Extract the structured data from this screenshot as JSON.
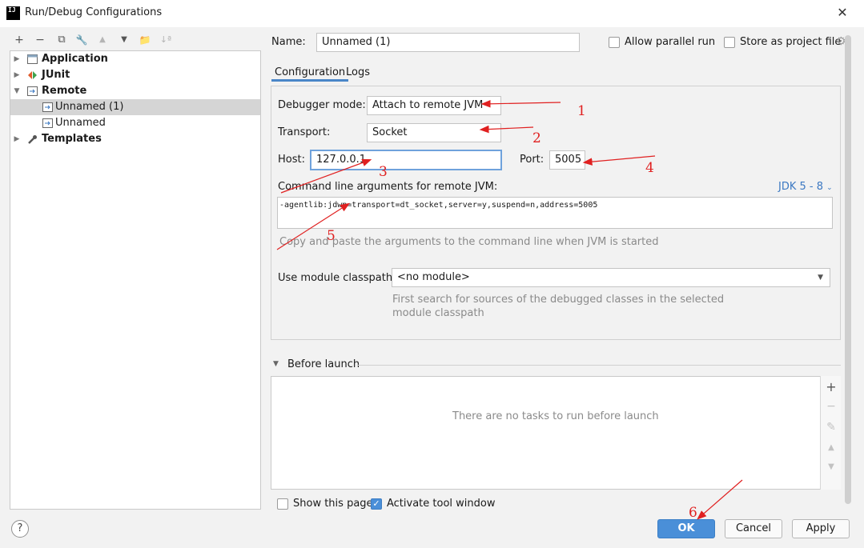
{
  "window": {
    "title": "Run/Debug Configurations",
    "app_icon_text": "IJ",
    "close_glyph": "✕"
  },
  "toolbar": {
    "add": "+",
    "remove": "−",
    "copy": "⧉",
    "edit": "🔧",
    "move_up": "▲",
    "move_down": "▼",
    "folder": "📁",
    "sort": "↓ª"
  },
  "tree": {
    "items": [
      {
        "label": "Application",
        "bold": true
      },
      {
        "label": "JUnit",
        "bold": true
      },
      {
        "label": "Remote",
        "bold": true
      },
      {
        "label": "Unnamed (1)",
        "bold": false
      },
      {
        "label": "Unnamed",
        "bold": false
      },
      {
        "label": "Templates",
        "bold": true
      }
    ]
  },
  "config": {
    "name_label": "Name:",
    "name_value": "Unnamed (1)",
    "allow_parallel_label": "Allow parallel run",
    "store_project_label": "Store as project file",
    "tabs": [
      "Configuration",
      "Logs"
    ],
    "debugger_mode_label": "Debugger mode:",
    "debugger_mode_value": "Attach to remote JVM",
    "transport_label": "Transport:",
    "transport_value": "Socket",
    "host_label": "Host:",
    "host_value": "127.0.0.1",
    "port_label": "Port:",
    "port_value": "5005",
    "cmdline_label": "Command line arguments for remote JVM:",
    "jdk_link": "JDK 5 - 8",
    "cmdline_value": "-agentlib:jdwp=transport=dt_socket,server=y,suspend=n,address=5005",
    "cmdline_hint": "Copy and paste the arguments to the command line when JVM is started",
    "module_label": "Use module classpath:",
    "module_value": "<no module>",
    "module_hint_line1": "First search for sources of the debugged classes in the selected",
    "module_hint_line2": "module classpath"
  },
  "before_launch": {
    "title": "Before launch",
    "empty_text": "There are no tasks to run before launch",
    "tools": [
      "+",
      "−",
      "✎",
      "▲",
      "▼"
    ]
  },
  "options": {
    "show_page_label": "Show this page",
    "activate_tool_label": "Activate tool window",
    "show_page_checked": false,
    "activate_tool_checked": true
  },
  "buttons": {
    "help": "?",
    "ok": "OK",
    "cancel": "Cancel",
    "apply": "Apply"
  },
  "annotations": [
    "1",
    "2",
    "3",
    "4",
    "5",
    "6"
  ],
  "colors": {
    "accent": "#4a8fd8",
    "annotation": "#e02020"
  }
}
